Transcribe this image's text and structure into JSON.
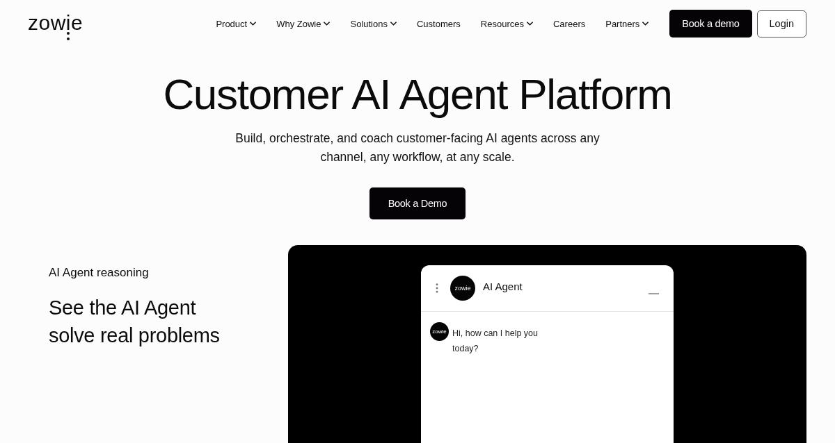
{
  "header": {
    "logo": "zowie",
    "nav": [
      {
        "label": "Product",
        "dropdown": true
      },
      {
        "label": "Why Zowie",
        "dropdown": true
      },
      {
        "label": "Solutions",
        "dropdown": true
      },
      {
        "label": "Customers",
        "dropdown": false
      },
      {
        "label": "Resources",
        "dropdown": true
      },
      {
        "label": "Careers",
        "dropdown": false
      },
      {
        "label": "Partners",
        "dropdown": true
      }
    ],
    "demo_button": "Book a demo",
    "login_button": "Login"
  },
  "hero": {
    "title": "Customer AI Agent Platform",
    "subtitle": "Build, orchestrate, and coach customer-facing AI agents across any channel, any workflow, at any scale.",
    "button": "Book a Demo"
  },
  "feature": {
    "eyebrow": "AI Agent reasoning",
    "heading": "See the AI Agent solve real problems"
  },
  "chat": {
    "avatar_label": "zowie",
    "title": "AI Agent",
    "messages": [
      {
        "avatar_label": "zowie",
        "text": "Hi, how can I help you today?"
      }
    ]
  }
}
